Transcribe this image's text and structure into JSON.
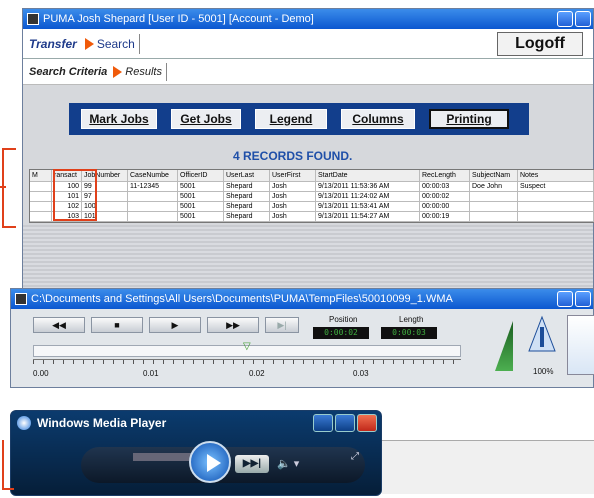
{
  "main_window": {
    "title": "PUMA  Josh Shepard [User ID - 5001] [Account - Demo]",
    "tabs": {
      "transfer": "Transfer",
      "search": "Search"
    },
    "logoff": "Logoff",
    "subtabs": {
      "criteria": "Search Criteria",
      "results": "Results"
    },
    "toolbar": {
      "mark_jobs": "Mark Jobs",
      "get_jobs": "Get Jobs",
      "legend": "Legend",
      "columns": "Columns",
      "printing": "Printing"
    },
    "records_found": "4 RECORDS FOUND.",
    "grid": {
      "columns": [
        "M",
        "ransact",
        "JobNumber",
        "CaseNumbe",
        "OfficerID",
        "UserLast",
        "UserFirst",
        "StartDate",
        "RecLength",
        "SubjectNam",
        "Notes"
      ],
      "rows": [
        [
          "",
          "100",
          "99",
          "11-12345",
          "5001",
          "Shepard",
          "Josh",
          "9/13/2011 11:53:36 AM",
          "00:00:03",
          "Doe John",
          "Suspect"
        ],
        [
          "",
          "101",
          "97",
          "",
          "5001",
          "Shepard",
          "Josh",
          "9/13/2011 11:24:02 AM",
          "00:00:02",
          "",
          ""
        ],
        [
          "",
          "102",
          "100",
          "",
          "5001",
          "Shepard",
          "Josh",
          "9/13/2011 11:53:41 AM",
          "00:00:00",
          "",
          ""
        ],
        [
          "",
          "103",
          "101",
          "",
          "5001",
          "Shepard",
          "Josh",
          "9/13/2011 11:54:27 AM",
          "00:00:19",
          "",
          ""
        ]
      ]
    }
  },
  "media_window": {
    "title": "C:\\Documents and Settings\\All Users\\Documents\\PUMA\\TempFiles\\50010099_1.WMA",
    "buttons": [
      "◀◀",
      "■",
      "▶",
      "▶▶",
      "▶|"
    ],
    "position_label": "Position",
    "length_label": "Length",
    "position_value": "0:00:02",
    "length_value": "0:00:03",
    "ruler_labels": [
      "0.00",
      "0.01",
      "0.02",
      "0.03"
    ],
    "speed_label": "100%"
  },
  "wmp": {
    "title": "Windows Media Player"
  }
}
